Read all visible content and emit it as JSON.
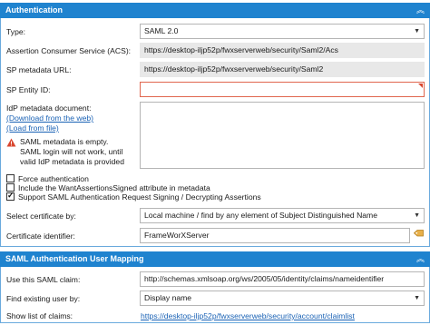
{
  "authentication": {
    "header": "Authentication",
    "type_label": "Type:",
    "type_value": "SAML 2.0",
    "acs_label": "Assertion Consumer Service (ACS):",
    "acs_value": "https://desktop-iljp52p/fwxserverweb/security/Saml2/Acs",
    "sp_metadata_label": "SP metadata URL:",
    "sp_metadata_value": "https://desktop-iljp52p/fwxserverweb/security/Saml2",
    "sp_entity_label": "SP Entity ID:",
    "sp_entity_value": "",
    "idp_label": "IdP metadata document:",
    "download_link": "(Download from the web)",
    "load_link": "(Load from file)",
    "warning_text": "SAML metadata is empty. SAML login will not work, until valid IdP metadata is provided",
    "force_auth_label": "Force authentication",
    "want_signed_label": "Include the WantAssertionsSigned attribute in metadata",
    "support_signing_label": "Support SAML Authentication Request Signing / Decrypting Assertions",
    "force_auth_checked": false,
    "want_signed_checked": false,
    "support_signing_checked": true,
    "select_cert_label": "Select certificate by:",
    "select_cert_value": "Local machine / find by any element of Subject Distinguished Name",
    "cert_identifier_label": "Certificate identifier:",
    "cert_identifier_value": "FrameWorXServer"
  },
  "mapping": {
    "header": "SAML Authentication User Mapping",
    "claim_label": "Use this SAML claim:",
    "claim_value": "http://schemas.xmlsoap.org/ws/2005/05/identity/claims/nameidentifier",
    "find_user_label": "Find existing user by:",
    "find_user_value": "Display name",
    "show_claims_label": "Show list of claims:",
    "show_claims_link": "https://desktop-iljp52p/fwxserverweb/security/account/claimlist"
  },
  "icons": {
    "collapse": "chevron-up-icon",
    "warning": "warning-triangle-icon",
    "tag": "tag-icon",
    "dropdown": "chevron-down-icon"
  },
  "colors": {
    "header_bg": "#1f83cf",
    "link": "#1a62b5",
    "warning": "#d9462e"
  }
}
